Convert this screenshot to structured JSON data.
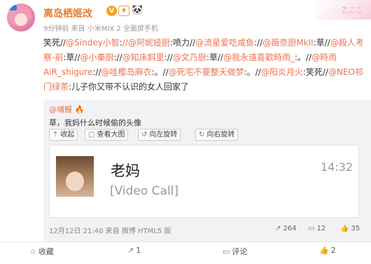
{
  "post": {
    "author": "离岛栖姬改",
    "meta": "9分钟前 来自 小米MIX 2 全面屏手机",
    "corner_text": "乙ここ",
    "segments": [
      {
        "t": "笑死//",
        "m": false
      },
      {
        "t": "@Sindey小智",
        "m": true
      },
      {
        "t": ":",
        "m": false
      },
      {
        "t": "//@阿妮娅厨",
        "m": true
      },
      {
        "t": ":喷力//",
        "m": false
      },
      {
        "t": "@流星爱吃咸鱼",
        "m": true
      },
      {
        "t": "://",
        "m": false
      },
      {
        "t": "@薇奈厨MkII",
        "m": true
      },
      {
        "t": ":草//",
        "m": false
      },
      {
        "t": "@殺人考察-前",
        "m": true
      },
      {
        "t": ":草//",
        "m": false
      },
      {
        "t": "@小秦厨",
        "m": true
      },
      {
        "t": "://",
        "m": false
      },
      {
        "t": "@知床斜里",
        "m": true
      },
      {
        "t": "://",
        "m": false
      },
      {
        "t": "@文乃厨",
        "m": true
      },
      {
        "t": ":草//",
        "m": false
      },
      {
        "t": "@我永遠喜歡時雨_",
        "m": true
      },
      {
        "t": ":。//",
        "m": false
      },
      {
        "t": "@時雨AiR_shigure",
        "m": true
      },
      {
        "t": "://",
        "m": false
      },
      {
        "t": "@哇樱岛麻衣",
        "m": true
      },
      {
        "t": ":。//",
        "m": false
      },
      {
        "t": "@死宅不要整天做梦",
        "m": true
      },
      {
        "t": ":。//",
        "m": false
      },
      {
        "t": "@阳炎月火",
        "m": true
      },
      {
        "t": ":笑死//",
        "m": false
      },
      {
        "t": "@NEO祁门绿茶",
        "m": true
      },
      {
        "t": ":儿子你又带不认识的女人回家了",
        "m": false
      }
    ]
  },
  "repost": {
    "user": "@埔鰻",
    "text": "草，我妈什么时候偷的头像",
    "actions": {
      "collapse": "收起",
      "view_large": "查看大图",
      "rotate_left": "向左旋转",
      "rotate_right": "向右旋转"
    },
    "image": {
      "contact_name": "老妈",
      "time": "14:32",
      "call_text": "[Video Call]"
    },
    "meta": "12月12日 21:40 来自 微博 HTML5 版",
    "reposts": "264",
    "comments": "12",
    "likes": "35"
  },
  "bottom_bar": {
    "favorite": "收藏",
    "repost": "1",
    "comment": "评论",
    "like": "2"
  },
  "colors": {
    "accent": "#eb7350",
    "username": "#e87d2d",
    "repost_bg": "#f2f2f5"
  }
}
